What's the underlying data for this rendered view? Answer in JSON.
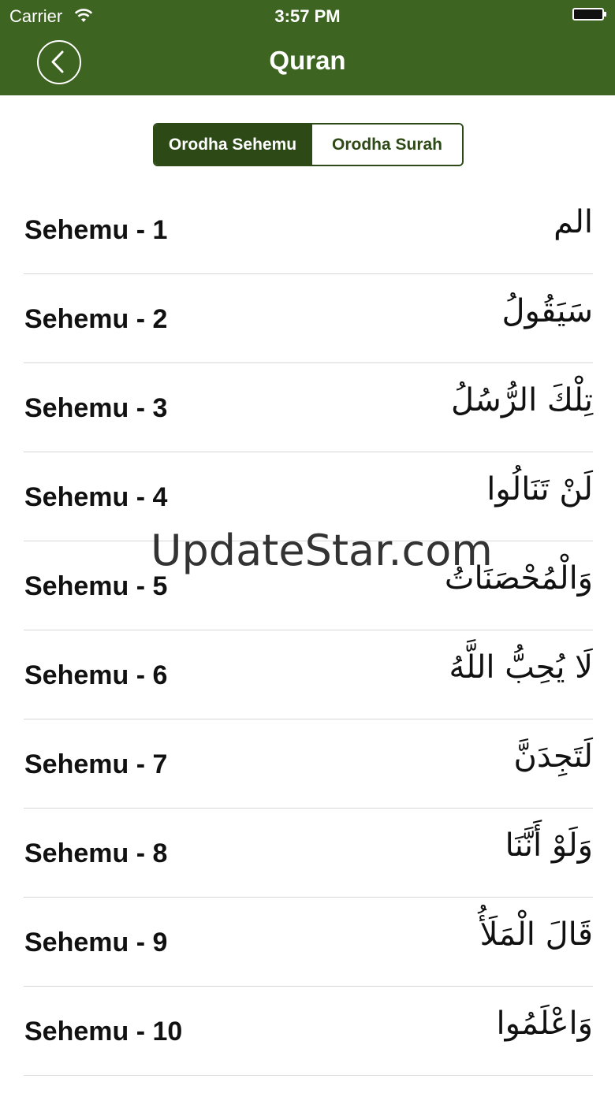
{
  "status_bar": {
    "carrier": "Carrier",
    "time": "3:57 PM"
  },
  "nav": {
    "title": "Quran",
    "back_icon": "chevron-left-circle-icon"
  },
  "segmented_control": {
    "options": [
      "Orodha Sehemu",
      "Orodha Surah"
    ],
    "selected": "Orodha Sehemu"
  },
  "sections": [
    {
      "label": "Sehemu - 1",
      "arabic": "الم"
    },
    {
      "label": "Sehemu - 2",
      "arabic": "سَيَقُولُ"
    },
    {
      "label": "Sehemu - 3",
      "arabic": "تِلْكَ الرُّسُلُ"
    },
    {
      "label": "Sehemu - 4",
      "arabic": "لَنْ تَنَالُوا"
    },
    {
      "label": "Sehemu - 5",
      "arabic": "وَالْمُحْصَنَاتُ"
    },
    {
      "label": "Sehemu - 6",
      "arabic": "لَا يُحِبُّ اللَّهُ"
    },
    {
      "label": "Sehemu - 7",
      "arabic": "لَتَجِدَنَّ"
    },
    {
      "label": "Sehemu - 8",
      "arabic": "وَلَوْ أَنَّنَا"
    },
    {
      "label": "Sehemu - 9",
      "arabic": "قَالَ الْمَلَأُ"
    },
    {
      "label": "Sehemu - 10",
      "arabic": "وَاعْلَمُوا"
    }
  ],
  "watermark": "UpdateStar.com",
  "colors": {
    "header": "#3d6420",
    "segment_active": "#2d4a16"
  }
}
